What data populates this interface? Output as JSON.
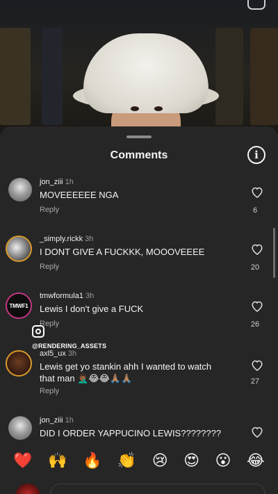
{
  "sheet": {
    "title": "Comments"
  },
  "comments": [
    {
      "username": "jon_ziii",
      "time": "1h",
      "text": "MOVEEEEEE NGA",
      "reply": "Reply",
      "likes": "6"
    },
    {
      "username": "_simply.rickk",
      "time": "3h",
      "text": "I DONT GIVE A FUCKKK, MOOOVEEEE",
      "reply": "Reply",
      "likes": "20"
    },
    {
      "username": "tmwformula1",
      "time": "3h",
      "text": "Lewis I don't give a FUCK",
      "reply": "Reply",
      "likes": "26",
      "avatar_text": "TMWF1"
    },
    {
      "username": "axl5_ux",
      "time": "3h",
      "text": "Lewis get yo stankin ahh I wanted to watch that man 🤦🏾‍♂️😂😂🙏🏽🙏🏽",
      "reply": "Reply",
      "likes": "27"
    },
    {
      "username": "jon_ziii",
      "time": "1h",
      "text": "DID I ORDER YAPPUCINO LEWIS????????"
    }
  ],
  "watermark": {
    "text": "@RENDERING_ASSETS",
    "icon": "instagram-icon"
  },
  "emoji_reactions": [
    "❤️",
    "🙌",
    "🔥",
    "👏",
    "😢",
    "😍",
    "😮",
    "😂"
  ],
  "colors": {
    "sheet_background": "#262626",
    "story_ring": "#d99a2b",
    "secondary_text": "#a8a8a8"
  }
}
